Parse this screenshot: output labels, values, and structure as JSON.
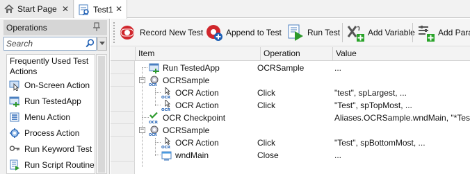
{
  "tabs": [
    {
      "label": "Start Page",
      "icon": "home-icon",
      "close": "✕"
    },
    {
      "label": "Test1",
      "icon": "keyword-test-icon",
      "close": "✕"
    }
  ],
  "operations_panel": {
    "title": "Operations",
    "search_placeholder": "Search",
    "group_title": "Frequently Used Test Actions",
    "items": [
      {
        "label": "On-Screen Action",
        "icon": "on-screen-action-icon"
      },
      {
        "label": "Run TestedApp",
        "icon": "run-tested-app-icon"
      },
      {
        "label": "Menu Action",
        "icon": "menu-action-icon"
      },
      {
        "label": "Process Action",
        "icon": "process-action-icon"
      },
      {
        "label": "Run Keyword Test",
        "icon": "run-keyword-test-icon"
      },
      {
        "label": "Run Script Routine",
        "icon": "run-script-routine-icon"
      }
    ]
  },
  "toolbar": {
    "record_new_test": "Record New Test",
    "append_to_test": "Append to Test",
    "run_test": "Run Test",
    "add_variable": "Add Variable",
    "add_parameter": "Add Para"
  },
  "grid": {
    "columns": [
      "Item",
      "Operation",
      "Value"
    ],
    "rows": [
      {
        "item": "Run TestedApp",
        "operation": "OCRSample",
        "value": "...",
        "level": 0,
        "expander": "",
        "icon": "run-tested-app-icon"
      },
      {
        "item": "OCRSample",
        "operation": "",
        "value": "",
        "level": 0,
        "expander": "−",
        "icon": "ocr-object-icon"
      },
      {
        "item": "OCR Action",
        "operation": "Click",
        "value": "\"test\", spLargest, ...",
        "level": 1,
        "expander": "",
        "icon": "ocr-action-icon"
      },
      {
        "item": "OCR Action",
        "operation": "Click",
        "value": "\"Test\", spTopMost, ...",
        "level": 1,
        "expander": "",
        "icon": "ocr-action-icon"
      },
      {
        "item": "OCR Checkpoint",
        "operation": "",
        "value": "Aliases.OCRSample.wndMain, \"*Test*\"",
        "level": 0,
        "expander": "",
        "icon": "ocr-checkpoint-icon"
      },
      {
        "item": "OCRSample",
        "operation": "",
        "value": "",
        "level": 0,
        "expander": "−",
        "icon": "ocr-object-icon"
      },
      {
        "item": "OCR Action",
        "operation": "Click",
        "value": "\"Test\", spBottomMost, ...",
        "level": 1,
        "expander": "",
        "icon": "ocr-action-icon"
      },
      {
        "item": "wndMain",
        "operation": "Close",
        "value": "...",
        "level": 1,
        "expander": "",
        "icon": "window-icon"
      }
    ]
  },
  "colors": {
    "record": "#d0262c",
    "run": "#2e9a2e",
    "ocr_blue": "#1e5fb4",
    "plus_green": "#29a329"
  }
}
